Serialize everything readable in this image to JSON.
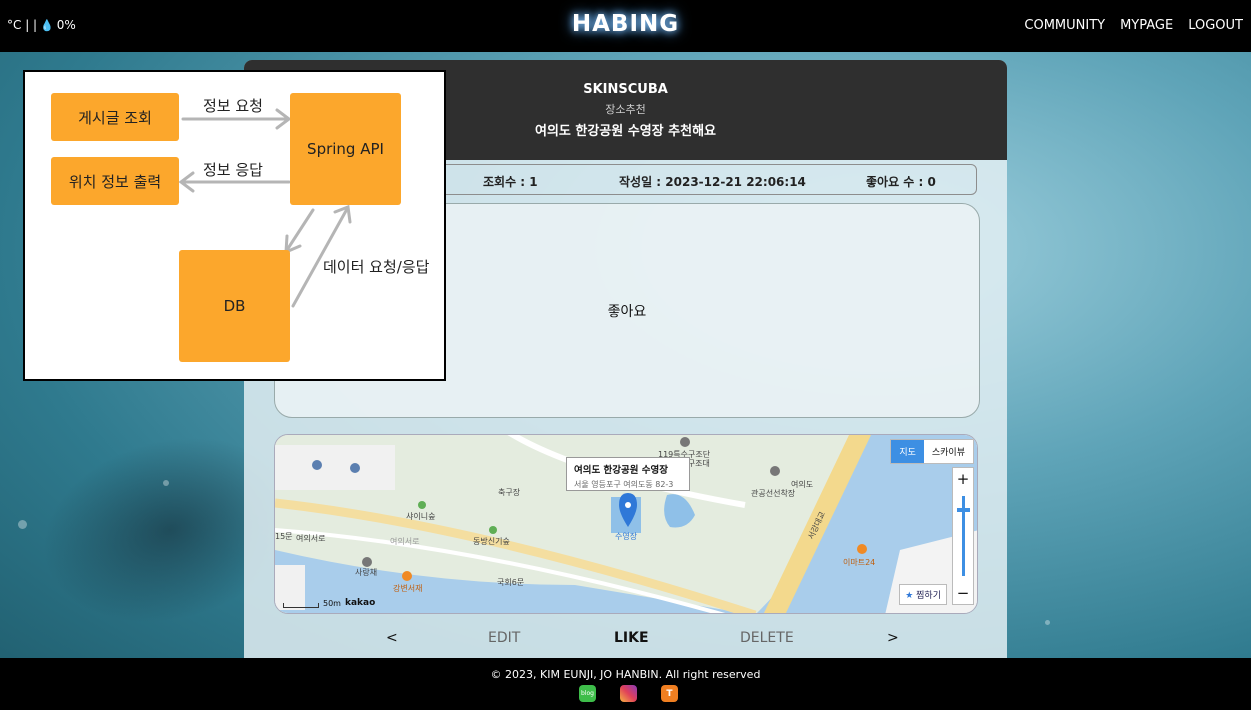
{
  "header": {
    "weather_text": "°C | |",
    "humidity": "0%",
    "brand": "HABING",
    "nav": [
      "COMMUNITY",
      "MYPAGE",
      "LOGOUT"
    ]
  },
  "post": {
    "category": "SKINSCUBA",
    "subcategory": "장소추천",
    "title": "여의도 한강공원 수영장 추천해요",
    "views": "조회수 : 1",
    "date": "작성일 : 2023-12-21 22:06:14",
    "likes": "좋아요 수 : 0",
    "content": "좋아요"
  },
  "map": {
    "place_name": "여의도 한강공원 수영장",
    "place_address": "서울 영등포구 여의도동 82-3",
    "toggle": [
      "지도",
      "스카이뷰"
    ],
    "zoom_in": "+",
    "zoom_out": "−",
    "fav_label": "찜하기",
    "scale": "50m",
    "provider": "kakao",
    "labels": [
      "119특수구조단",
      "수난구조대",
      "여의도",
      "관공선선착장",
      "축구장",
      "샤이니숲",
      "동방신기숲",
      "여의서로",
      "사랑채",
      "강변서재",
      "국회6문",
      "수영장",
      "서강대교",
      "이마트24",
      "15문",
      "여의서로"
    ]
  },
  "actions": {
    "prev": "<",
    "edit": "EDIT",
    "like": "LIKE",
    "delete": "DELETE",
    "next": ">"
  },
  "footer": {
    "copyright": "© 2023, KIM EUNJI, JO HANBIN. All right reserved",
    "icons": [
      "blog",
      "instagram",
      "tistory"
    ],
    "blog_text": "blog",
    "tistory_text": "T"
  },
  "flow": {
    "nodes": {
      "post_view": "게시글 조회",
      "location_output": "위치 정보 출력",
      "spring_api": "Spring API",
      "db": "DB"
    },
    "edges": {
      "request": "정보 요청",
      "response": "정보 응답",
      "db_io": "데이터 요청/응답"
    }
  },
  "colors": {
    "node": "#fca72c",
    "accent": "#3d8fe3",
    "header_bg": "#000000"
  }
}
